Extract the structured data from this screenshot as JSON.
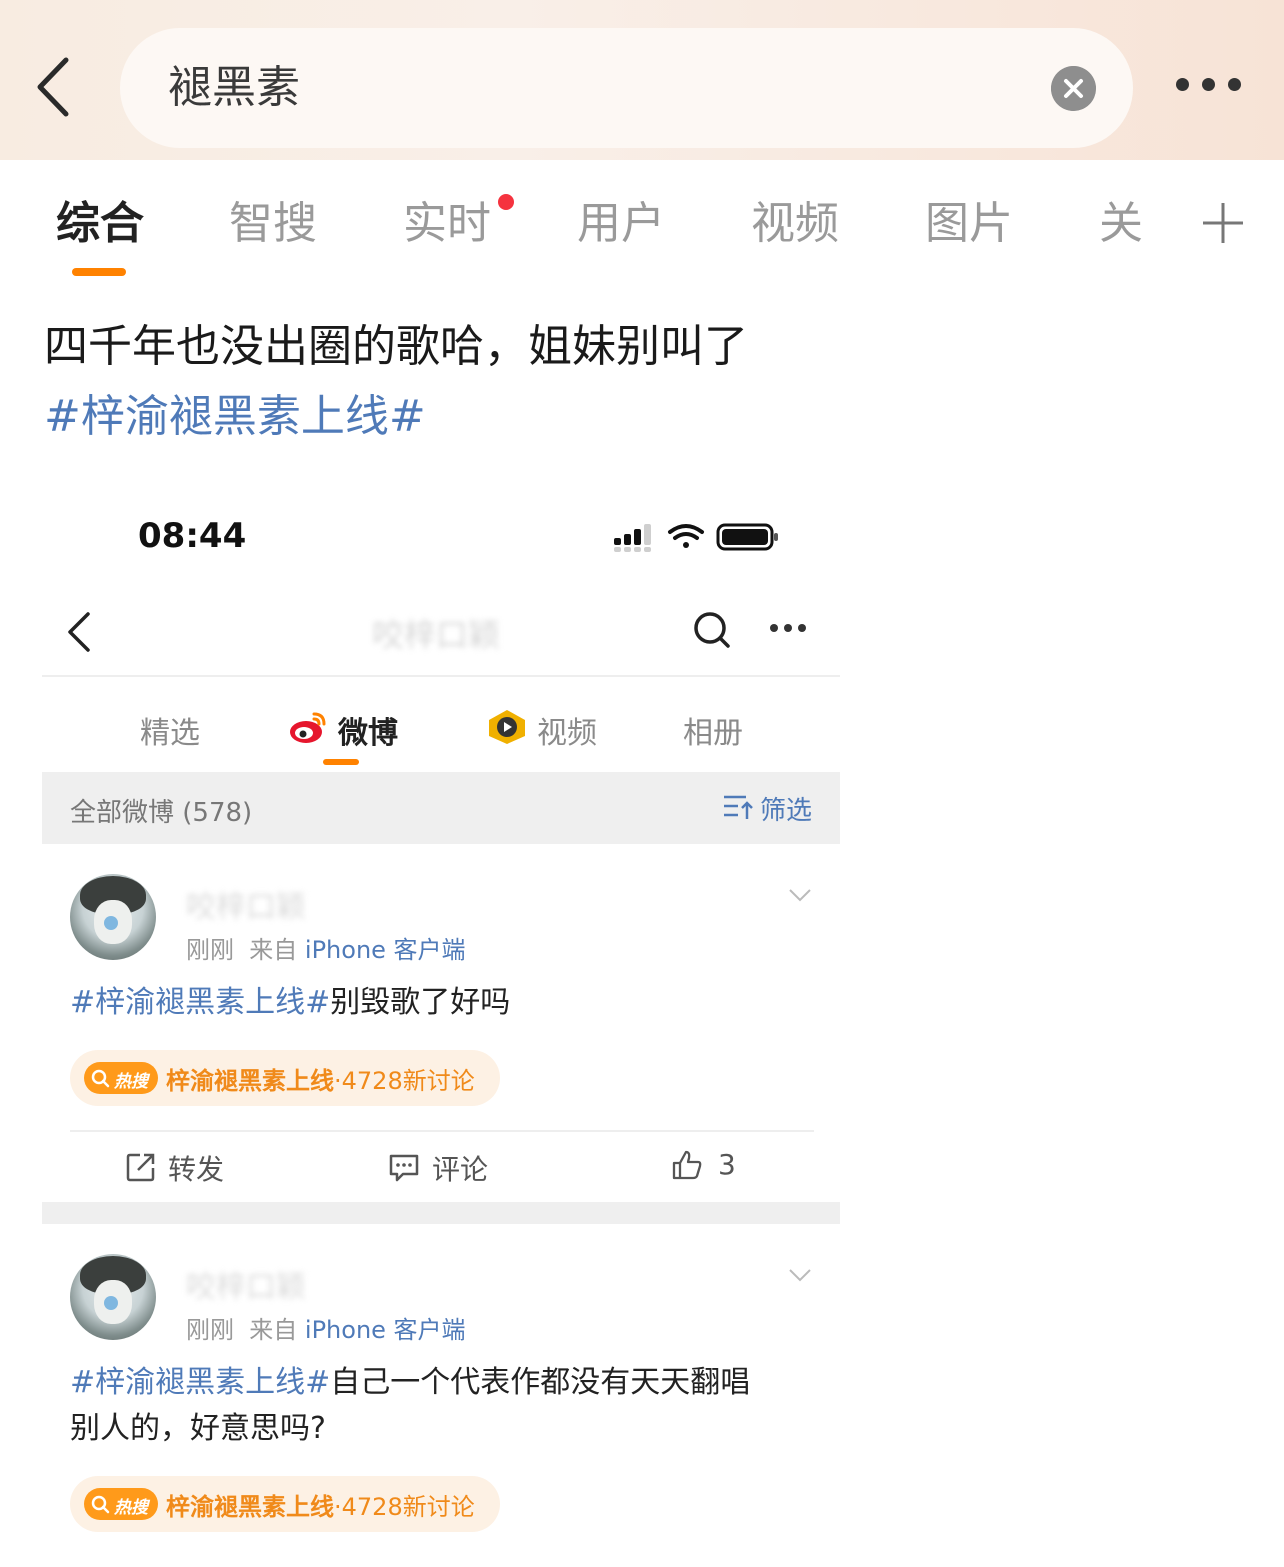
{
  "search": {
    "query": "褪黑素"
  },
  "tabs": [
    "综合",
    "智搜",
    "实时",
    "用户",
    "视频",
    "图片",
    "关"
  ],
  "post": {
    "text": "四千年也没出圈的歌哈，姐妹别叫了",
    "hashtag": "#梓渝褪黑素上线#"
  },
  "embedded": {
    "status_time": "08:44",
    "title": "咬梓口颖",
    "tabs": [
      "精选",
      "微博",
      "视频",
      "相册"
    ],
    "all_label": "全部微博 (578)",
    "filter_label": "筛选",
    "posts": [
      {
        "username": "咬梓口颖",
        "time": "刚刚",
        "from": "来自",
        "source": "iPhone 客户端",
        "hashtag": "#梓渝褪黑素上线#",
        "text": "别毁歌了好吗",
        "hot_badge": "热搜",
        "hot_topic": "梓渝褪黑素上线",
        "hot_count": "·4728新讨论",
        "repost_label": "转发",
        "comment_label": "评论",
        "likes": "3"
      },
      {
        "username": "咬梓口颖",
        "time": "刚刚",
        "from": "来自",
        "source": "iPhone 客户端",
        "hashtag": "#梓渝褪黑素上线#",
        "text_line1": "自己一个代表作都没有天天翻唱",
        "text_line2": "别人的，好意思吗?",
        "hot_badge": "热搜",
        "hot_topic": "梓渝褪黑素上线",
        "hot_count": "·4728新讨论"
      }
    ]
  },
  "colors": {
    "accent": "#ff8200",
    "link": "#4f7ab8",
    "notify": "#f5333f"
  }
}
